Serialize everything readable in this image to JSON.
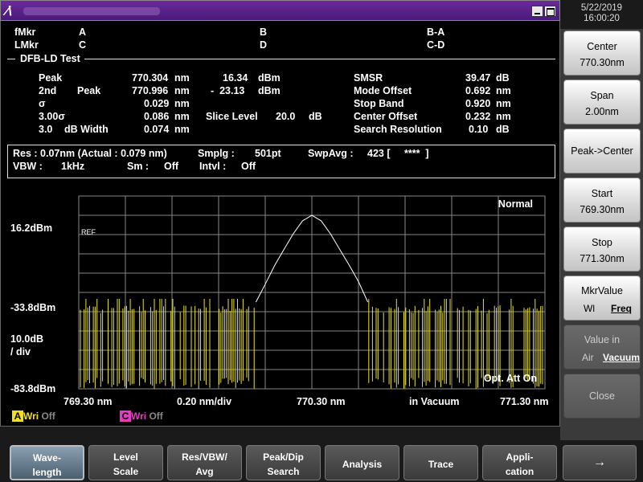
{
  "datetime": {
    "date": "5/22/2019",
    "time": "16:00:20"
  },
  "markers": {
    "fmkr_label": "fMkr",
    "lmkr_label": "LMkr",
    "a": "A",
    "b": "B",
    "c": "C",
    "d": "D",
    "ba": "B-A",
    "cd": "C-D"
  },
  "section_title": "DFB-LD Test",
  "results": {
    "peak": {
      "label": "Peak",
      "wl": "770.304",
      "wl_unit": "nm",
      "level": "16.34",
      "level_unit": "dBm"
    },
    "second_peak": {
      "label1": "2nd",
      "label2": "Peak",
      "wl": "770.996",
      "wl_unit": "nm",
      "level": "-  23.13",
      "level_unit": "dBm"
    },
    "sigma": {
      "label": "σ",
      "value": "0.029",
      "unit": "nm"
    },
    "three_sigma": {
      "label": "3.00σ",
      "value": "0.086",
      "unit": "nm"
    },
    "width": {
      "label1": "3.0",
      "label2": "dB Width",
      "value": "0.074",
      "unit": "nm"
    },
    "slice_level": {
      "label": "Slice Level",
      "value": "20.0",
      "unit": "dB"
    },
    "smsr": {
      "label": "SMSR",
      "value": "39.47",
      "unit": "dB"
    },
    "mode_offset": {
      "label": "Mode Offset",
      "value": "0.692",
      "unit": "nm"
    },
    "stop_band": {
      "label": "Stop Band",
      "value": "0.920",
      "unit": "nm"
    },
    "center_offset": {
      "label": "Center Offset",
      "value": "0.232",
      "unit": "nm"
    },
    "search_resolution": {
      "label": "Search Resolution",
      "value": "0.10",
      "unit": "dB"
    }
  },
  "settings": {
    "res": "Res : 0.07nm (Actual : 0.079 nm)",
    "smplg": "Smplg :",
    "smplg_value": "501pt",
    "swpavg": "SwpAvg :",
    "swpavg_value": "423 [",
    "swpavg_stars": "****  ]",
    "vbw": "VBW :",
    "vbw_value": "1kHz",
    "sm": "Sm :",
    "sm_value": "Off",
    "intvl": "Intvl :",
    "intvl_value": "Off"
  },
  "graph": {
    "mode": "Normal",
    "ref_label": "REF",
    "y_top": "16.2dBm",
    "y_mid": "-33.8dBm",
    "y_scale1": "10.0dB",
    "y_scale2": "/ div",
    "y_bottom": "-83.8dBm",
    "x_start": "769.30 nm",
    "x_div": "0.20 nm/div",
    "x_center": "770.30 nm",
    "x_medium": "in Vacuum",
    "x_stop": "771.30 nm",
    "opt_att": "Opt. Att On",
    "colors": {
      "trace": "#ffffff",
      "noise": "#e8e030",
      "grid": "#888888"
    }
  },
  "chart_data": {
    "type": "line",
    "xlabel": "",
    "ylabel": "",
    "xlim": [
      769.3,
      771.3
    ],
    "ylim": [
      -83.8,
      16.2
    ],
    "series": [
      {
        "x": [
          770.06,
          770.1,
          770.14,
          770.18,
          770.22,
          770.26,
          770.3,
          770.34,
          770.38,
          770.42,
          770.46,
          770.5,
          770.54
        ],
        "y": [
          -33.8,
          -23.5,
          -12.8,
          -3.5,
          5.5,
          13.0,
          16.2,
          13.0,
          5.5,
          -3.5,
          -12.5,
          -22.0,
          -33.8
        ]
      }
    ]
  },
  "trace_indicators": {
    "a": {
      "letter": "A",
      "wri": "Wri",
      "state": "Off",
      "color": "#f0e020"
    },
    "c": {
      "letter": "C",
      "wri": "Wri",
      "state": "Off",
      "color": "#e040c0"
    }
  },
  "softkeys": {
    "center": {
      "label": "Center",
      "value": "770.30nm"
    },
    "span": {
      "label": "Span",
      "value": "2.00nm"
    },
    "peak_center": {
      "label": "Peak->Center"
    },
    "start": {
      "label": "Start",
      "value": "769.30nm"
    },
    "stop": {
      "label": "Stop",
      "value": "771.30nm"
    },
    "mkr_value": {
      "label": "MkrValue",
      "opt1": "Wl",
      "opt2": "Freq"
    },
    "value_in": {
      "label": "Value in",
      "opt1": "Air",
      "opt2": "Vacuum"
    },
    "close": {
      "label": "Close"
    }
  },
  "function_keys": {
    "wavelength": {
      "l1": "Wave-",
      "l2": "length"
    },
    "level_scale": {
      "l1": "Level",
      "l2": "Scale"
    },
    "res_vbw_avg": {
      "l1": "Res/VBW/",
      "l2": "Avg"
    },
    "peak_dip": {
      "l1": "Peak/Dip",
      "l2": "Search"
    },
    "analysis": {
      "label": "Analysis"
    },
    "trace": {
      "label": "Trace"
    },
    "application": {
      "l1": "Appli-",
      "l2": "cation"
    },
    "next": {
      "label": "→"
    }
  }
}
